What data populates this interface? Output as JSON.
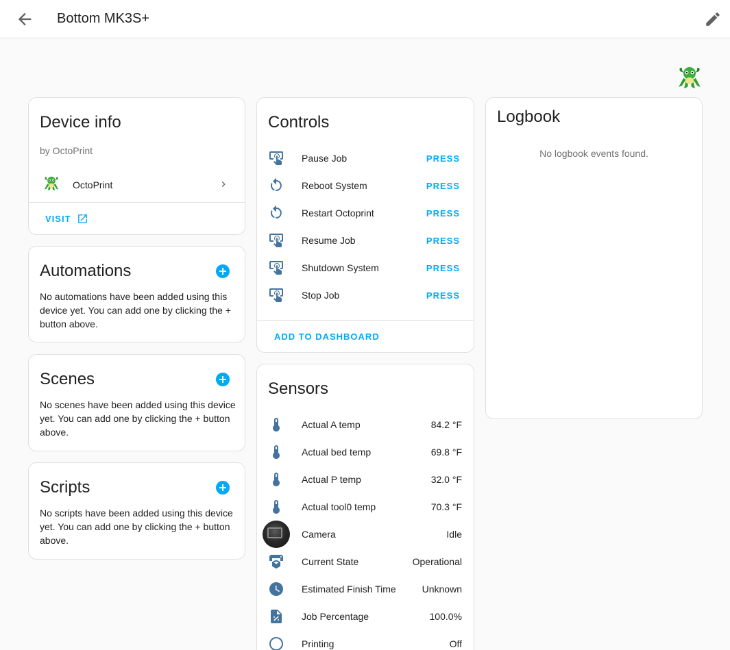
{
  "header": {
    "title": "Bottom MK3S+"
  },
  "device_info": {
    "title": "Device info",
    "by": "by OctoPrint",
    "device_name": "OctoPrint",
    "visit_label": "VISIT"
  },
  "automations": {
    "title": "Automations",
    "text": "No automations have been added using this device yet. You can add one by clicking the + button above."
  },
  "scenes": {
    "title": "Scenes",
    "text": "No scenes have been added using this device yet. You can add one by clicking the + button above."
  },
  "scripts": {
    "title": "Scripts",
    "text": "No scripts have been added using this device yet. You can add one by clicking the + button above."
  },
  "controls": {
    "title": "Controls",
    "press_label": "PRESS",
    "add_to_dashboard": "ADD TO DASHBOARD",
    "items": [
      {
        "label": "Pause Job",
        "icon": "gesture-tap-button-icon"
      },
      {
        "label": "Reboot System",
        "icon": "restart-icon"
      },
      {
        "label": "Restart Octoprint",
        "icon": "restart-icon"
      },
      {
        "label": "Resume Job",
        "icon": "gesture-tap-button-icon"
      },
      {
        "label": "Shutdown System",
        "icon": "gesture-tap-button-icon"
      },
      {
        "label": "Stop Job",
        "icon": "gesture-tap-button-icon"
      }
    ]
  },
  "sensors": {
    "title": "Sensors",
    "items": [
      {
        "label": "Actual A temp",
        "value": "84.2 °F",
        "icon": "thermometer-icon"
      },
      {
        "label": "Actual bed temp",
        "value": "69.8 °F",
        "icon": "thermometer-icon"
      },
      {
        "label": "Actual P temp",
        "value": "32.0 °F",
        "icon": "thermometer-icon"
      },
      {
        "label": "Actual tool0 temp",
        "value": "70.3 °F",
        "icon": "thermometer-icon"
      },
      {
        "label": "Camera",
        "value": "Idle",
        "icon": "camera-thumbnail"
      },
      {
        "label": "Current State",
        "value": "Operational",
        "icon": "printer-3d-icon"
      },
      {
        "label": "Estimated Finish Time",
        "value": "Unknown",
        "icon": "clock-icon"
      },
      {
        "label": "Job Percentage",
        "value": "100.0%",
        "icon": "file-percent-icon"
      },
      {
        "label": "Printing",
        "value": "Off",
        "icon": "circle-outline-icon"
      }
    ]
  },
  "logbook": {
    "title": "Logbook",
    "empty_text": "No logbook events found."
  },
  "colors": {
    "accent": "#03a9f4",
    "icon": "#44739e",
    "background": "#fafafa"
  }
}
